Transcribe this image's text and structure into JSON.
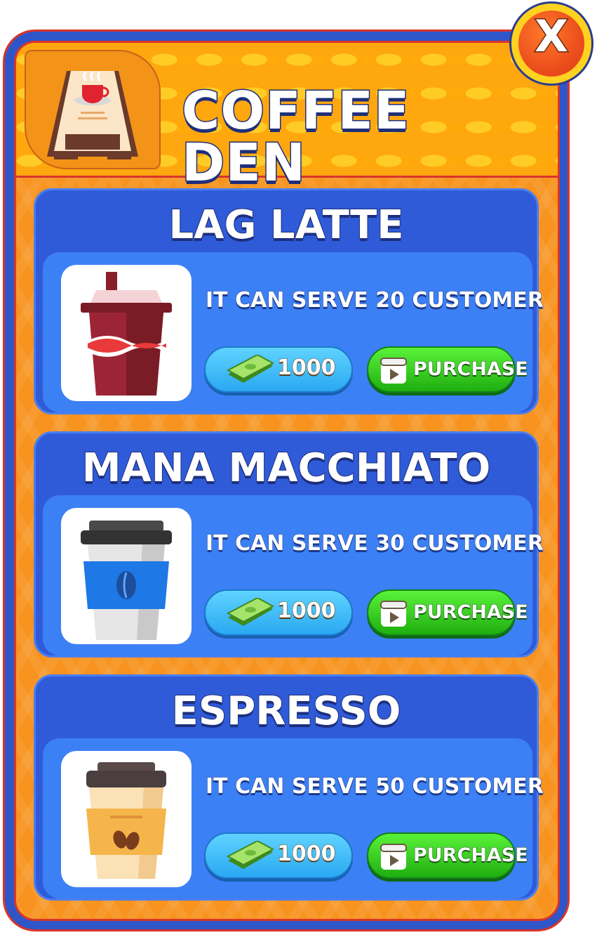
{
  "panel": {
    "title": "COFFEE DEN",
    "close_label": "X",
    "logo_icon": "coffee-sign-board-icon"
  },
  "colors": {
    "panel_blue": "#2e56c9",
    "panel_orange": "#f7931e",
    "card_blue": "#2f5bd8",
    "card_body_blue": "#3c80f5",
    "price_button": "#2aa8f2",
    "purchase_button": "#1fae0f",
    "border_red": "#d9342a"
  },
  "items": [
    {
      "name": "LAG LATTE",
      "description": "IT CAN SERVE 20 CUSTOMER",
      "price": "1000",
      "purchase_label": "PURCHASE",
      "icon": "red-latte-cup-icon"
    },
    {
      "name": "MANA MACCHIATO",
      "description": "IT CAN SERVE 30 CUSTOMER",
      "price": "1000",
      "purchase_label": "PURCHASE",
      "icon": "blue-coffee-cup-icon"
    },
    {
      "name": "ESPRESSO",
      "description": "IT CAN SERVE 50 CUSTOMER",
      "price": "1000",
      "purchase_label": "PURCHASE",
      "icon": "espresso-cup-icon"
    }
  ]
}
